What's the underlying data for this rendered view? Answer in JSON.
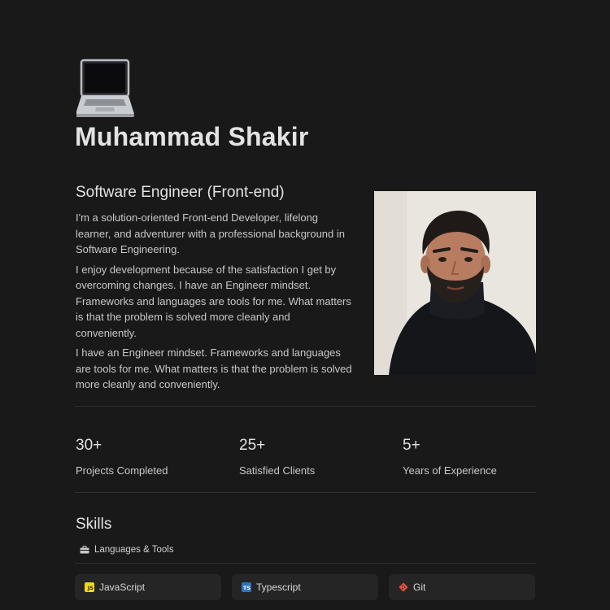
{
  "profile": {
    "name": "Muhammad Shakir",
    "role": "Software Engineer (Front-end)",
    "bio": [
      "I'm a solution-oriented Front-end Developer, lifelong learner, and adventurer with a professional background in Software Engineering.",
      "I enjoy development because of the satisfaction I get by overcoming changes. I have an Engineer mindset. Frameworks and languages are tools for me. What matters is that the problem is solved more cleanly and conveniently.",
      "I have an Engineer mindset. Frameworks and languages are tools for me. What matters is that the problem is solved more cleanly and conveniently."
    ]
  },
  "stats": [
    {
      "value": "30+",
      "label": "Projects Completed"
    },
    {
      "value": "25+",
      "label": "Satisfied Clients"
    },
    {
      "value": "5+",
      "label": "Years of Experience"
    }
  ],
  "skills": {
    "title": "Skills",
    "section_label": "Languages & Tools",
    "items": [
      {
        "label": "JavaScript",
        "icon": "javascript-icon",
        "badge": "JS",
        "color": "#f0d81e"
      },
      {
        "label": "Typescript",
        "icon": "typescript-icon",
        "badge": "TS",
        "color": "#2f74c0"
      },
      {
        "label": "Git",
        "icon": "git-icon",
        "color": "#e8513a"
      }
    ]
  },
  "icons": {
    "header": "laptop-icon",
    "section": "briefcase-icon"
  },
  "colors": {
    "background": "#191919",
    "card": "#252525",
    "text": "#e3e3e3"
  }
}
